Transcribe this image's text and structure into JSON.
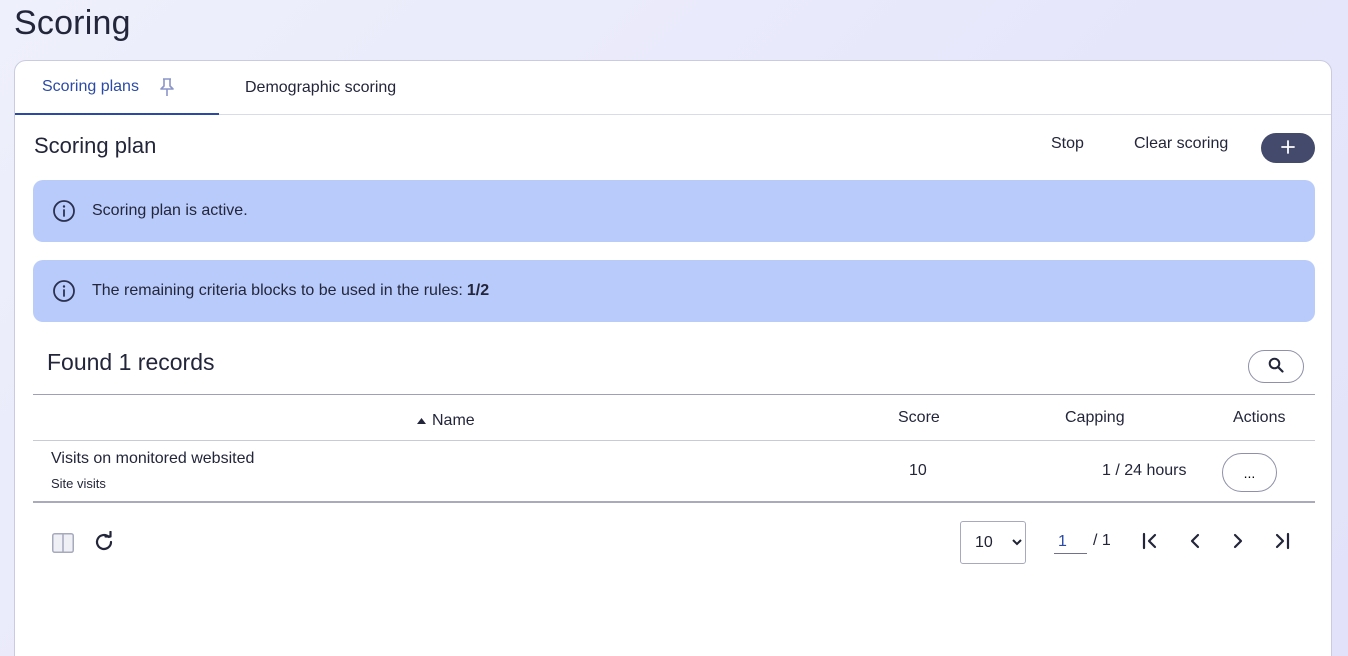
{
  "page": {
    "title": "Scoring"
  },
  "tabs": [
    {
      "label": "Scoring plans",
      "active": true
    },
    {
      "label": "Demographic scoring",
      "active": false
    }
  ],
  "section": {
    "title": "Scoring plan",
    "stop_label": "Stop",
    "clear_label": "Clear scoring",
    "add_label": "+"
  },
  "alerts": {
    "active_text": "Scoring plan is active.",
    "criteria_text": "The remaining criteria blocks to be used in the rules:",
    "criteria_value": "1/2"
  },
  "records": {
    "found_text": "Found 1 records",
    "columns": {
      "name": "Name",
      "score": "Score",
      "capping": "Capping",
      "actions": "Actions"
    },
    "rows": [
      {
        "name": "Visits on monitored websited",
        "subtitle": "Site visits",
        "score": "10",
        "capping": "1 / 24 hours",
        "actions_label": "..."
      }
    ]
  },
  "pagination": {
    "page_size": "10",
    "page_size_options": [
      "10"
    ],
    "current_page": "1",
    "total_pages": "/ 1"
  },
  "colors": {
    "accent": "#2b4aa6",
    "alert_bg": "#b9cbfb",
    "primary_button": "#434a6b"
  }
}
